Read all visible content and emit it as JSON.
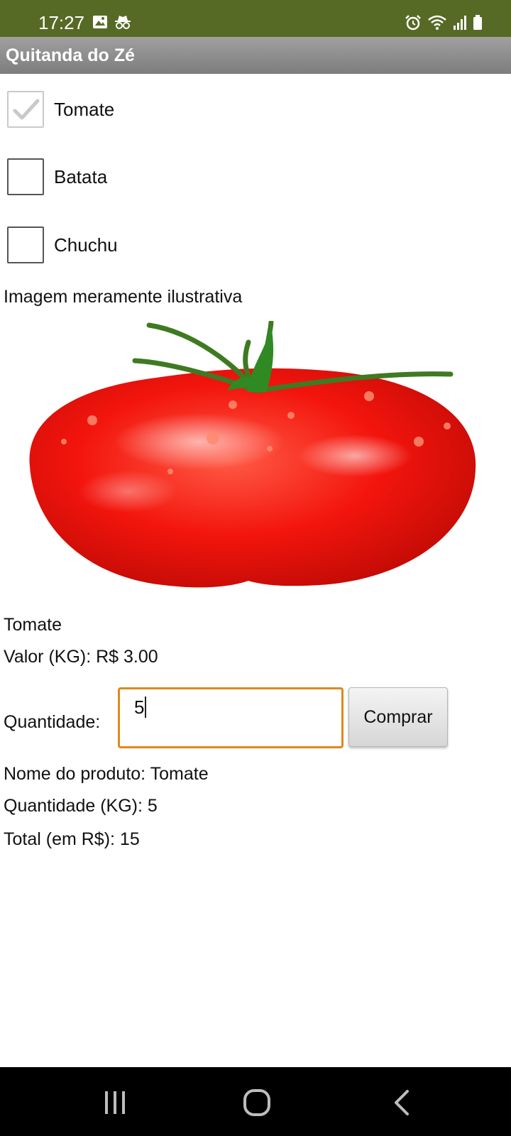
{
  "status_bar": {
    "time": "17:27",
    "left_icons": [
      "image-icon",
      "incognito-icon"
    ],
    "right_icons": [
      "alarm-icon",
      "wifi-icon",
      "signal-icon",
      "battery-icon"
    ],
    "background_color": "#566a25"
  },
  "app": {
    "title": "Quitanda do Zé"
  },
  "products": [
    {
      "label": "Tomate",
      "checked": true
    },
    {
      "label": "Batata",
      "checked": false
    },
    {
      "label": "Chuchu",
      "checked": false
    }
  ],
  "image_caption": "Imagem meramente ilustrativa",
  "selected": {
    "name": "Tomate",
    "price_label": "Valor (KG): R$ 3.00"
  },
  "quantity": {
    "label": "Quantidade:",
    "value": "5",
    "focus_color": "#e0881e"
  },
  "buy_button": {
    "label": "Comprar"
  },
  "summary": {
    "product_name": "Nome do produto:  Tomate",
    "quantity": "Quantidade (KG):  5",
    "total": "Total (em R$): 15"
  },
  "nav_bar": {
    "buttons": [
      "recents-icon",
      "home-icon",
      "back-icon"
    ]
  }
}
